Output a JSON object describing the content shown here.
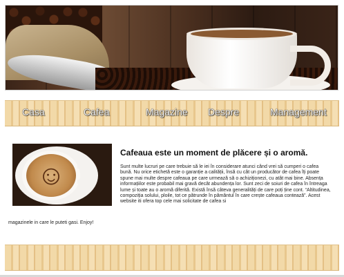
{
  "hero": {
    "image": "coffee-cup-beans-banner"
  },
  "nav": {
    "items": [
      {
        "label": "Casa"
      },
      {
        "label": "Cafea"
      },
      {
        "label": "Magazine"
      },
      {
        "label": "Despre"
      },
      {
        "label": "Management"
      }
    ]
  },
  "content": {
    "image": "latte-art-smiley",
    "headline": "Cafeaua este un moment de plăcere și o aromă.",
    "paragraph": "Sunt multe lucruri pe care trebuie să le iei în considerare atunci când vrei să cumperi o cafea bună. Nu orice etichetă este o garanție a calității, însă cu cât un producător de cafea îți poate spune mai multe despre cafeaua pe care urmează să o achiziționezi, cu atât mai bine. Absența informațiilor este probabil mai gravă decât abundența lor. Sunt zeci de soiuri de cafea în întreaga lume și toate au o aromă diferită. Există însă câteva generalități de care poți ține cont. “Altitudinea, compoziția solului, ploile, tot ce pătrunde în pământul în care crește cafeaua contează”. Acest website iti ofera top cele mai solicitate de cafea si",
    "paragraph_end": "magazinele in care le puteti gasi. Enjoy!"
  },
  "colors": {
    "nav_wood": "#f2d9a8",
    "nav_text": "#ffffff",
    "text": "#222222"
  }
}
